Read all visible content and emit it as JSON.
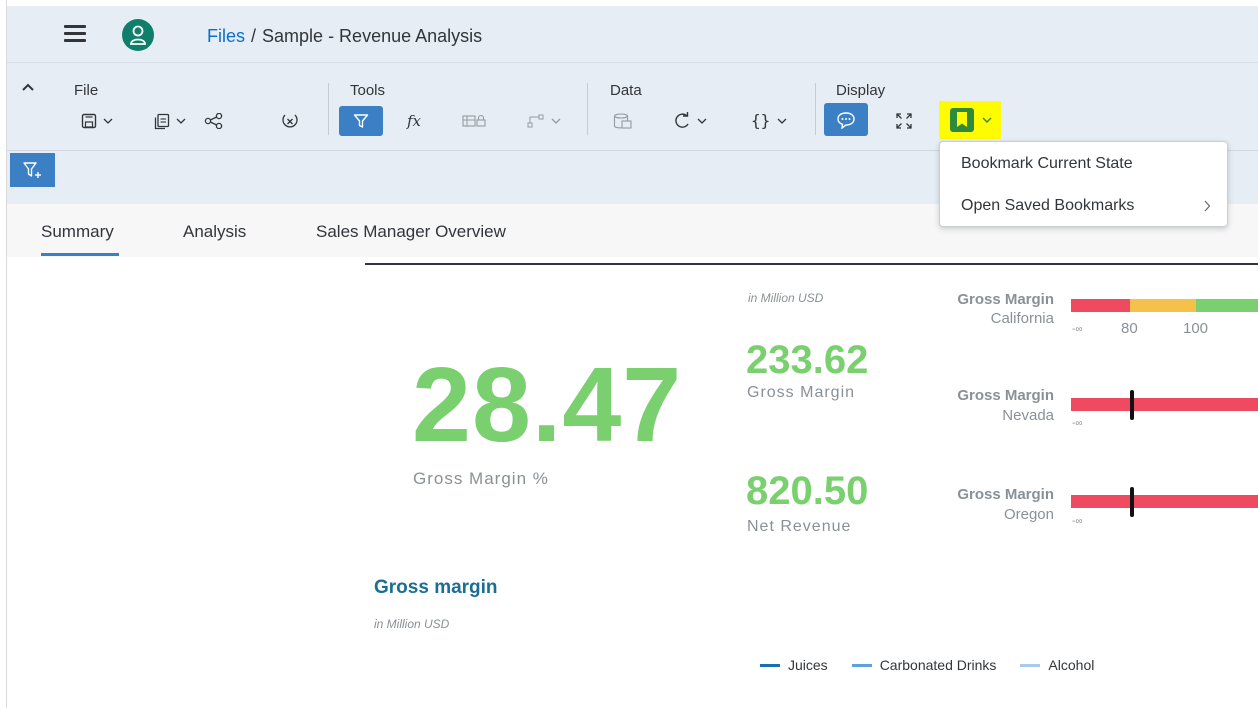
{
  "shell": {
    "breadcrumb_root": "Files",
    "breadcrumb_sep": "/",
    "breadcrumb_current": "Sample - Revenue Analysis"
  },
  "toolbar": {
    "groups": {
      "file": "File",
      "tools": "Tools",
      "data": "Data",
      "display": "Display"
    },
    "accent_color": "#3b7fc4",
    "highlight_color": "#fffb00"
  },
  "bookmark_menu": {
    "items": [
      {
        "label": "Bookmark Current State"
      },
      {
        "label": "Open Saved Bookmarks",
        "arrow": ">"
      }
    ]
  },
  "tabs": {
    "items": [
      "Summary",
      "Analysis",
      "Sales Manager Overview"
    ],
    "active": "Summary"
  },
  "kpis": {
    "main": {
      "value": "28.47",
      "label": "Gross Margin %"
    },
    "unit_note": "in Million USD",
    "gross_margin": {
      "value": "233.62",
      "label": "Gross Margin"
    },
    "net_revenue": {
      "value": "820.50",
      "label": "Net Revenue"
    },
    "value_color": "#7ad06e"
  },
  "gauges": [
    {
      "title": "Gross Margin",
      "region": "California",
      "ticks": [
        "-∞",
        "80",
        "100"
      ]
    },
    {
      "title": "Gross Margin",
      "region": "Nevada",
      "ticks": [
        "-∞"
      ]
    },
    {
      "title": "Gross Margin",
      "region": "Oregon",
      "ticks": [
        "-∞"
      ]
    }
  ],
  "gauge_colors": {
    "red": "#ef4a60",
    "yellow": "#f6c14b",
    "green": "#7ad06e"
  },
  "section": {
    "title": "Gross margin",
    "unit_note": "in Million USD"
  },
  "legend": [
    {
      "name": "Juices",
      "color": "#1a6fb0"
    },
    {
      "name": "Carbonated Drinks",
      "color": "#5aa3de"
    },
    {
      "name": "Alcohol",
      "color": "#a9cbeb"
    }
  ]
}
